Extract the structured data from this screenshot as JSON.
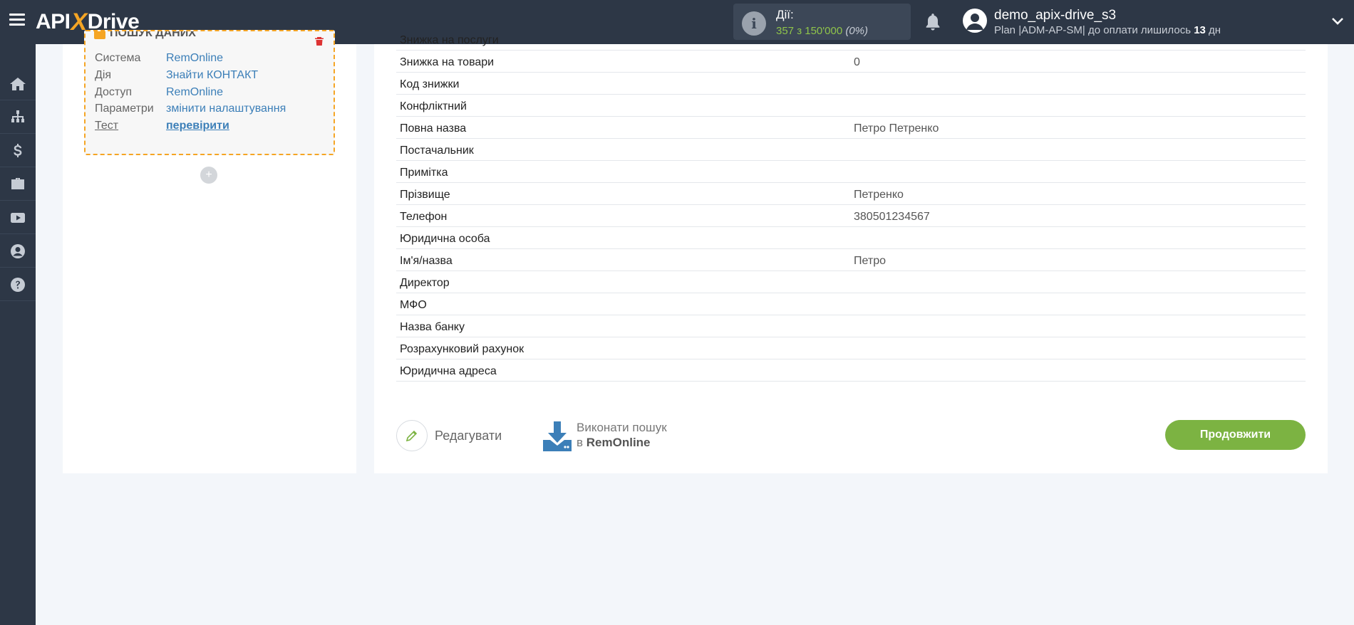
{
  "header": {
    "logo_text_left": "API",
    "logo_text_x": "X",
    "logo_text_right": "Drive",
    "actions_label": "Дії:",
    "actions_count": "357 з 150'000",
    "actions_percent": "(0%)",
    "user_name": "demo_apix-drive_s3",
    "plan_prefix": "Plan |ADM-AP-SM| до оплати лишилось",
    "plan_days": "13",
    "plan_suffix": "дн"
  },
  "sidebar": {
    "items": [
      "home-icon",
      "sitemap-icon",
      "dollar-icon",
      "briefcase-icon",
      "youtube-icon",
      "user-icon",
      "help-icon"
    ]
  },
  "block": {
    "title": "ПОШУК ДАНИХ",
    "rows": [
      {
        "key": "Система",
        "value": "RemOnline"
      },
      {
        "key": "Дія",
        "value": "Знайти КОНТАКТ"
      },
      {
        "key": "Доступ",
        "value": "RemOnline"
      },
      {
        "key": "Параметри",
        "value": "змінити налаштування"
      },
      {
        "key": "Тест",
        "value": "перевірити"
      }
    ],
    "add_label": "+"
  },
  "fields": [
    {
      "key": "Знижка на послуги",
      "value": ""
    },
    {
      "key": "Знижка на товари",
      "value": "0"
    },
    {
      "key": "Код знижки",
      "value": ""
    },
    {
      "key": "Конфліктний",
      "value": ""
    },
    {
      "key": "Повна назва",
      "value": "Петро Петренко"
    },
    {
      "key": "Постачальник",
      "value": ""
    },
    {
      "key": "Примітка",
      "value": ""
    },
    {
      "key": "Прізвище",
      "value": "Петренко"
    },
    {
      "key": "Телефон",
      "value": "380501234567"
    },
    {
      "key": "Юридична особа",
      "value": ""
    },
    {
      "key": "Ім'я/назва",
      "value": "Петро"
    },
    {
      "key": "Директор",
      "value": ""
    },
    {
      "key": "МФО",
      "value": ""
    },
    {
      "key": "Назва банку",
      "value": ""
    },
    {
      "key": "Розрахунковий рахунок",
      "value": ""
    },
    {
      "key": "Юридична адреса",
      "value": ""
    }
  ],
  "footer": {
    "edit_label": "Редагувати",
    "search_line1": "Виконати пошук",
    "search_line2_prefix": "в",
    "search_line2_name": "RemOnline",
    "continue_label": "Продовжити"
  }
}
